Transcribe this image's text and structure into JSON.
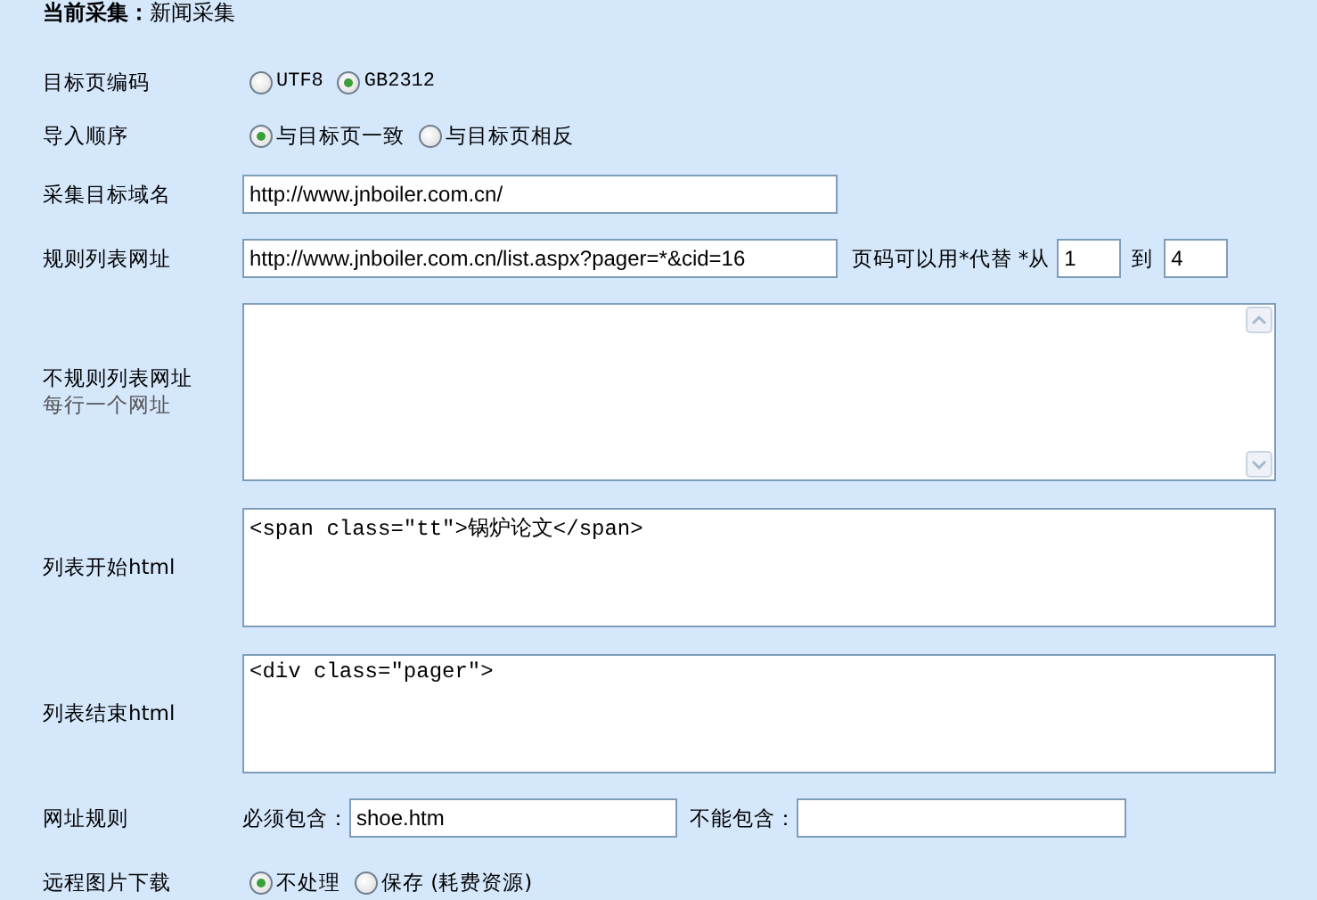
{
  "title": {
    "label": "当前采集：",
    "value": "新闻采集"
  },
  "rows": [
    {
      "kind": "radio",
      "label": "目标页编码",
      "options": [
        {
          "label": "UTF8",
          "selected": false
        },
        {
          "label": "GB2312",
          "selected": true
        }
      ]
    },
    {
      "kind": "radio",
      "label": "导入顺序",
      "options": [
        {
          "label": "与目标页一致",
          "selected": true
        },
        {
          "label": "与目标页相反",
          "selected": false
        }
      ]
    },
    {
      "kind": "text",
      "label": "采集目标域名",
      "value": "http://www.jnboiler.com.cn/"
    },
    {
      "kind": "list_url",
      "label": "规则列表网址",
      "value": "http://www.jnboiler.com.cn/list.aspx?pager=*&cid=16",
      "hint": "页码可以用*代替 *从",
      "from": "1",
      "to_label": "到",
      "to": "4"
    },
    {
      "kind": "textarea",
      "label": "不规则列表网址",
      "sublabel": "每行一个网址",
      "scrollbar": true
    },
    {
      "kind": "textarea",
      "label": "列表开始html",
      "value": "<span class=\"tt\">锅炉论文</span>",
      "scrollbar": false
    },
    {
      "kind": "textarea",
      "label": "列表结束html",
      "value": "<div class=\"pager\">",
      "scrollbar": false
    },
    {
      "kind": "rules",
      "label": "网址规则",
      "include_label": "必须包含：",
      "include": "shoe.htm",
      "exclude_label": "不能包含："
    },
    {
      "kind": "radio",
      "label": "远程图片下载",
      "options": [
        {
          "label": "不处理",
          "selected": true
        },
        {
          "label": "保存 (耗费资源)",
          "selected": false
        }
      ]
    }
  ]
}
